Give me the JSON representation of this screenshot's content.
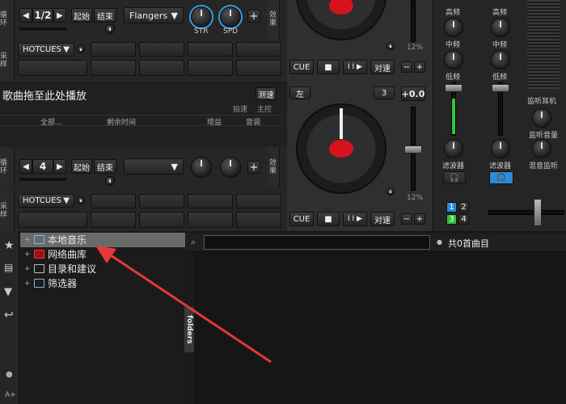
{
  "deck_top": {
    "side_label": "循环",
    "loop_prev": "◀",
    "loop_value": "1/2",
    "loop_next": "▶",
    "start_label": "起始",
    "end_label": "结束",
    "effect_select": "Flangers",
    "knob1_label": "STR",
    "knob2_label": "SPD",
    "plus": "+",
    "hotcues_side": "采样",
    "hotcues_label": "HOTCUES",
    "pitch_percent": "12%",
    "cue_label": "CUE",
    "stop_label": "■",
    "play_label": "I I ▶",
    "sync_label": "对速",
    "minus": "−",
    "plus2": "+"
  },
  "info_bar": {
    "drag_text": "歌曲拖至此处播放",
    "sync_btn": "测速",
    "beat_label": "拍速",
    "master_label": "主控",
    "col_all": "全部...",
    "col_remaining": "剩余时间",
    "col_gain": "增益",
    "col_key": "音调"
  },
  "deck_bottom": {
    "side_label": "循环",
    "left_btn": "左",
    "num_btn": "3",
    "pitch_value": "+0.0",
    "loop_prev": "◀",
    "loop_value": "4",
    "loop_next": "▶",
    "start_label": "起始",
    "end_label": "结束",
    "effect_select": "",
    "plus": "+",
    "hotcues_side": "采样",
    "hotcues_label": "HOTCUES",
    "pitch_percent": "12%",
    "cue_label": "CUE",
    "stop_label": "■",
    "play_label": "I I ▶",
    "sync_label": "对速",
    "minus": "−",
    "plus2": "+"
  },
  "mixer": {
    "high": "高频",
    "mid": "中频",
    "low": "低频",
    "filter": "滤波器",
    "headphone_monitor": "监听耳机",
    "mon_volume": "监听音量",
    "mon_mix": "混音监听",
    "deck_nums": [
      "1",
      "2",
      "3",
      "4"
    ]
  },
  "browser": {
    "tree": [
      {
        "label": "本地音乐",
        "icon": "monitor-icon"
      },
      {
        "label": "网络曲库",
        "icon": "cloud-icon"
      },
      {
        "label": "目录和建议",
        "icon": "list-icon"
      },
      {
        "label": "筛选器",
        "icon": "filter-folder-icon"
      }
    ],
    "folders_tab": "folders",
    "search_placeholder": "",
    "count_text": "共0首曲目"
  },
  "colors": {
    "accent_blue": "#2a8be0",
    "green_fader": "#31c43a",
    "arrow_red": "#e8363a",
    "deck_red": "#d8121c"
  }
}
